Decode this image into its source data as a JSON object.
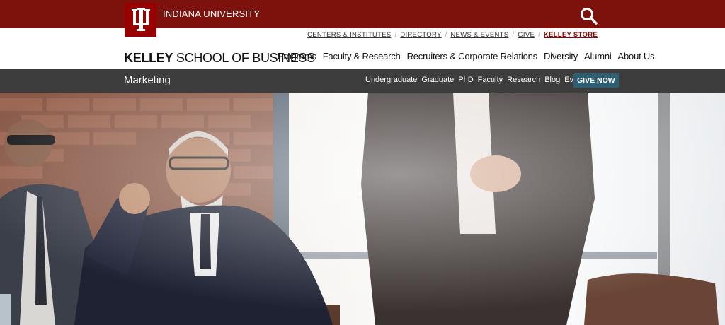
{
  "brand": {
    "university": "INDIANA UNIVERSITY",
    "logo_letters": "IU",
    "school_bold": "KELLEY",
    "school_rest": "SCHOOL OF BUSINESS"
  },
  "utility_links": [
    "CENTERS & INSTITUTES",
    "DIRECTORY",
    "NEWS & EVENTS",
    "GIVE"
  ],
  "store_link": "KELLEY STORE",
  "main_nav": [
    "Programs",
    "Faculty & Research",
    "Recruiters & Corporate Relations",
    "Diversity",
    "Alumni",
    "About Us"
  ],
  "department": {
    "title": "Marketing",
    "links": [
      "Undergraduate",
      "Graduate",
      "PhD",
      "Faculty",
      "Research",
      "Blog",
      "Events"
    ],
    "cta": "GIVE NOW"
  },
  "colors": {
    "crimson": "#7d110c",
    "dept_bar": "#3d3d3d",
    "cta": "#2d5e73"
  },
  "icons": {
    "search": "search-icon"
  }
}
